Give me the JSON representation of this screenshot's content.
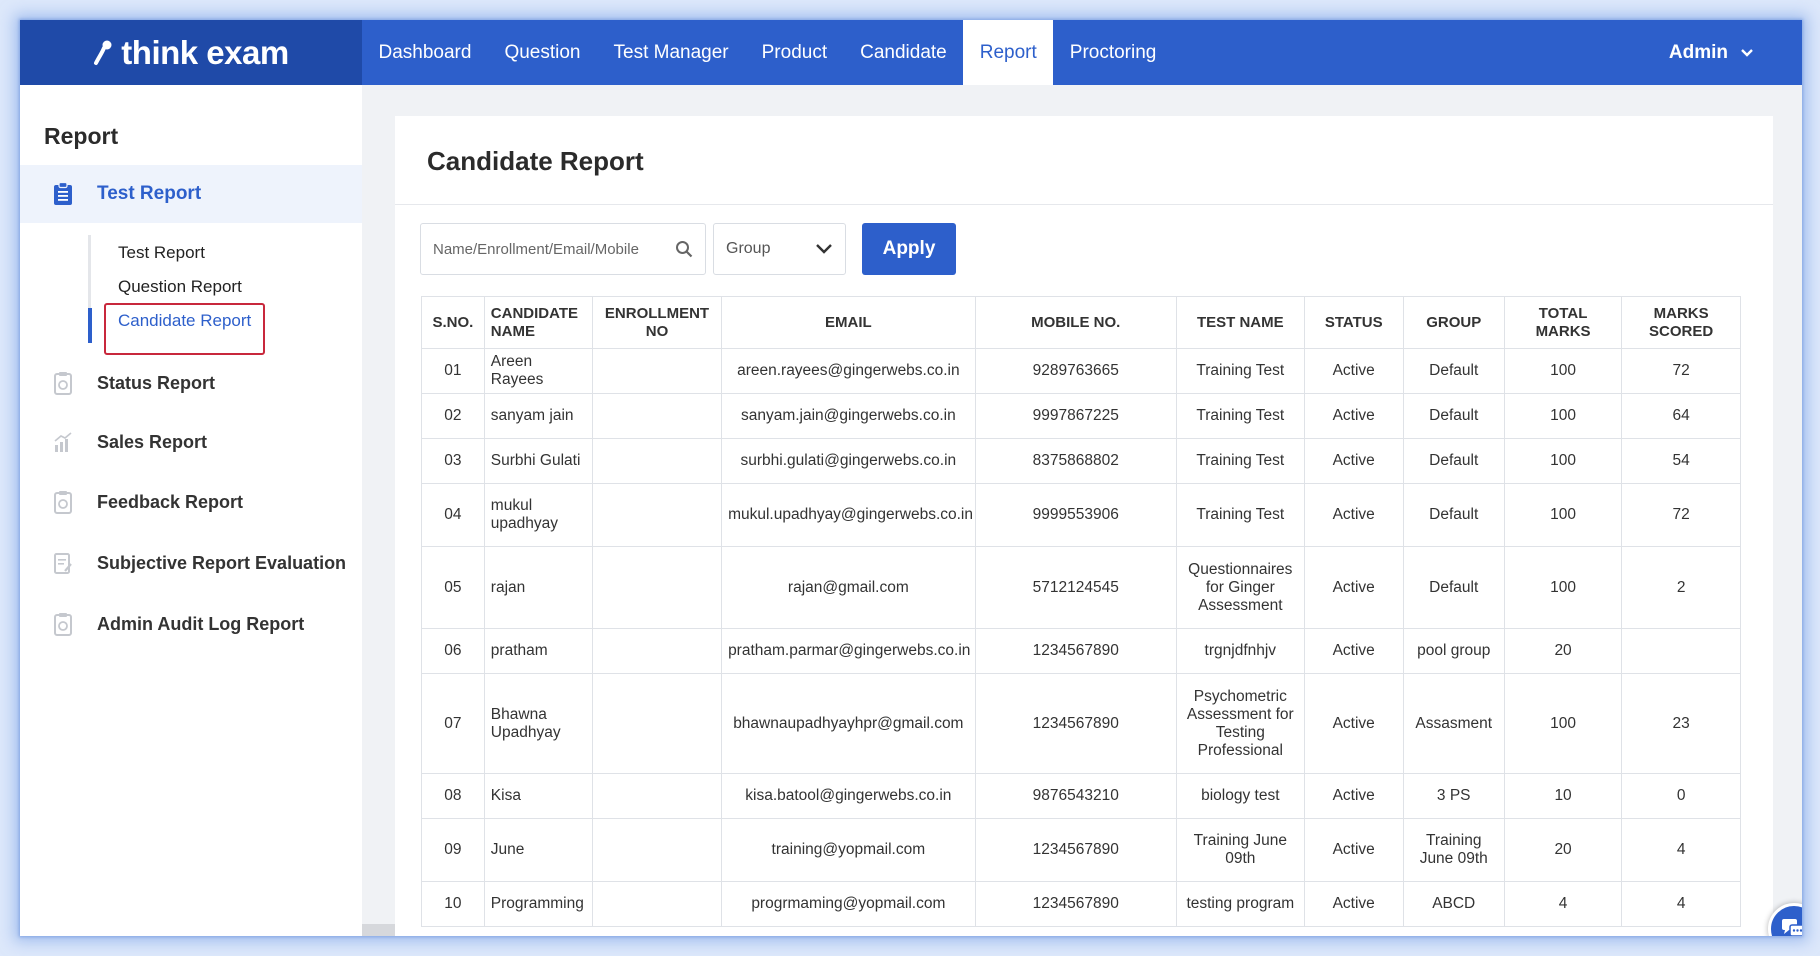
{
  "brand": {
    "name": "think exam"
  },
  "nav": {
    "items": [
      {
        "label": "Dashboard",
        "active": false
      },
      {
        "label": "Question",
        "active": false
      },
      {
        "label": "Test Manager",
        "active": false
      },
      {
        "label": "Product",
        "active": false
      },
      {
        "label": "Candidate",
        "active": false
      },
      {
        "label": "Report",
        "active": true
      },
      {
        "label": "Proctoring",
        "active": false
      }
    ],
    "user": "Admin"
  },
  "sidebar": {
    "title": "Report",
    "active_section": "Test Report",
    "submenu": [
      {
        "label": "Test Report"
      },
      {
        "label": "Question Report"
      },
      {
        "label": "Candidate Report",
        "active": true
      }
    ],
    "items": [
      {
        "label": "Status Report",
        "icon": "clipboard-icon"
      },
      {
        "label": "Sales Report",
        "icon": "chart-icon"
      },
      {
        "label": "Feedback Report",
        "icon": "clipboard-icon"
      },
      {
        "label": "Subjective Report Evaluation",
        "icon": "edit-doc-icon"
      },
      {
        "label": "Admin Audit Log Report",
        "icon": "clipboard-icon"
      }
    ]
  },
  "main": {
    "title": "Candidate Report",
    "search": {
      "placeholder": "Name/Enrollment/Email/Mobile",
      "value": ""
    },
    "group_filter": {
      "value": "Group"
    },
    "apply_label": "Apply",
    "table": {
      "headers": [
        "S.NO.",
        "CANDIDATE NAME",
        "ENROLLMENT NO",
        "EMAIL",
        "MOBILE NO.",
        "TEST NAME",
        "STATUS",
        "GROUP",
        "TOTAL MARKS",
        "MARKS SCORED"
      ],
      "rows": [
        [
          "01",
          "Areen Rayees",
          "",
          "areen.rayees@gingerwebs.co.in",
          "9289763665",
          "Training Test",
          "Active",
          "Default",
          "100",
          "72"
        ],
        [
          "02",
          "sanyam jain",
          "",
          "sanyam.jain@gingerwebs.co.in",
          "9997867225",
          "Training Test",
          "Active",
          "Default",
          "100",
          "64"
        ],
        [
          "03",
          "Surbhi Gulati",
          "",
          "surbhi.gulati@gingerwebs.co.in",
          "8375868802",
          "Training Test",
          "Active",
          "Default",
          "100",
          "54"
        ],
        [
          "04",
          "mukul upadhyay",
          "",
          "mukul.upadhyay@gingerwebs.co.in",
          "9999553906",
          "Training Test",
          "Active",
          "Default",
          "100",
          "72"
        ],
        [
          "05",
          "rajan",
          "",
          "rajan@gmail.com",
          "5712124545",
          "Questionnaires for Ginger Assessment",
          "Active",
          "Default",
          "100",
          "2"
        ],
        [
          "06",
          "pratham",
          "",
          "pratham.parmar@gingerwebs.co.in",
          "1234567890",
          "trgnjdfnhjv",
          "Active",
          "pool group",
          "20",
          ""
        ],
        [
          "07",
          "Bhawna Upadhyay",
          "",
          "bhawnaupadhyayhpr@gmail.com",
          "1234567890",
          "Psychometric Assessment for Testing Professional",
          "Active",
          "Assasment",
          "100",
          "23"
        ],
        [
          "08",
          "Kisa",
          "",
          "kisa.batool@gingerwebs.co.in",
          "9876543210",
          "biology test",
          "Active",
          "3 PS",
          "10",
          "0"
        ],
        [
          "09",
          "June",
          "",
          "training@yopmail.com",
          "1234567890",
          "Training June 09th",
          "Active",
          "Training June 09th",
          "20",
          "4"
        ],
        [
          "10",
          "Programming",
          "",
          "progrmaming@yopmail.com",
          "1234567890",
          "testing program",
          "Active",
          "ABCD",
          "4",
          "4"
        ]
      ]
    }
  },
  "colors": {
    "primary": "#2d5fcb",
    "primary_dark": "#1f4aa8",
    "highlight": "#c8283c"
  }
}
